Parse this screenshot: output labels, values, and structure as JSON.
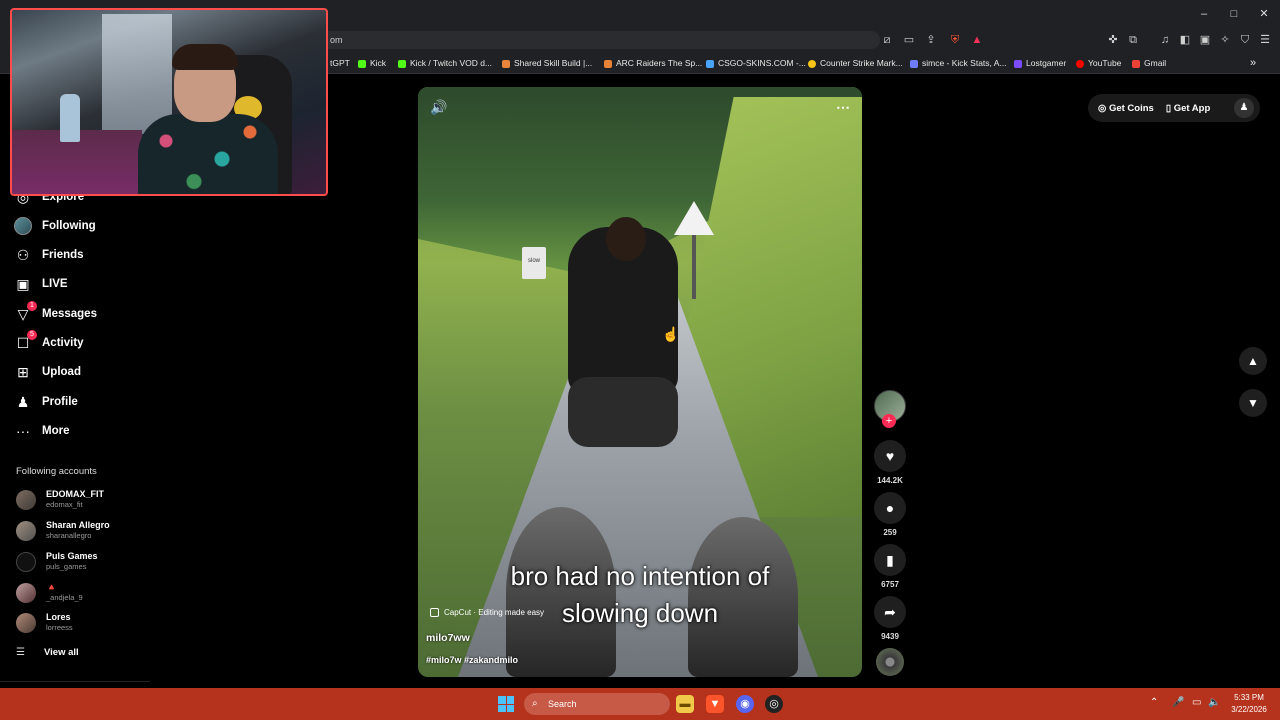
{
  "browser": {
    "url_suffix": "om",
    "window_controls": [
      "–",
      "□",
      "✕"
    ],
    "bookmarks": [
      {
        "label": "tGPT",
        "color": "#10a37f"
      },
      {
        "label": "Kick",
        "color": "#53fc18"
      },
      {
        "label": "Kick / Twitch VOD d...",
        "color": "#53fc18"
      },
      {
        "label": "Shared Skill Build |...",
        "color": "#e8833a"
      },
      {
        "label": "ARC Raiders The Sp...",
        "color": "#e8833a"
      },
      {
        "label": "CSGO-SKINS.COM -...",
        "color": "#4aa3ff"
      },
      {
        "label": "Counter Strike Mark...",
        "color": "#f5c518"
      },
      {
        "label": "simce - Kick Stats, A...",
        "color": "#6f7cff"
      },
      {
        "label": "Lostgamer",
        "color": "#7c4dff"
      },
      {
        "label": "YouTube",
        "color": "#ff0000"
      },
      {
        "label": "Gmail",
        "color": "#ea4335"
      }
    ]
  },
  "sidebar": {
    "nav": [
      {
        "label": "Explore",
        "icon": "compass-icon"
      },
      {
        "label": "Following",
        "icon": "following-avatar-icon"
      },
      {
        "label": "Friends",
        "icon": "friends-icon"
      },
      {
        "label": "LIVE",
        "icon": "live-icon"
      },
      {
        "label": "Messages",
        "icon": "messages-icon",
        "badge": "1"
      },
      {
        "label": "Activity",
        "icon": "activity-icon",
        "badge": "5"
      },
      {
        "label": "Upload",
        "icon": "upload-icon"
      },
      {
        "label": "Profile",
        "icon": "profile-icon"
      },
      {
        "label": "More",
        "icon": "more-icon"
      }
    ],
    "following_title": "Following accounts",
    "accounts": [
      {
        "name": "EDOMAX_FIT",
        "handle": "edomax_fit"
      },
      {
        "name": "Sharan Allegro",
        "handle": "sharanallegro"
      },
      {
        "name": "Puls Games",
        "handle": "puls_games"
      },
      {
        "name": "🔺",
        "handle": "_andjela_9"
      },
      {
        "name": "Lores",
        "handle": "lorreess"
      }
    ],
    "view_all": "View all"
  },
  "video": {
    "caption_line1": "bro had no intention of",
    "caption_line2": "slowing down",
    "capcut": "CapCut · Editing made easy",
    "username": "milo7ww",
    "tags": "#milo7w #zakandmilo",
    "sign_text": "slow"
  },
  "actions": {
    "likes": "144.2K",
    "comments": "259",
    "saves": "6757",
    "shares": "9439"
  },
  "topright": {
    "get_coins": "Get Coins",
    "get_app": "Get App"
  },
  "taskbar": {
    "search": "Search",
    "time": "5:33 PM",
    "date": "3/22/2026"
  }
}
